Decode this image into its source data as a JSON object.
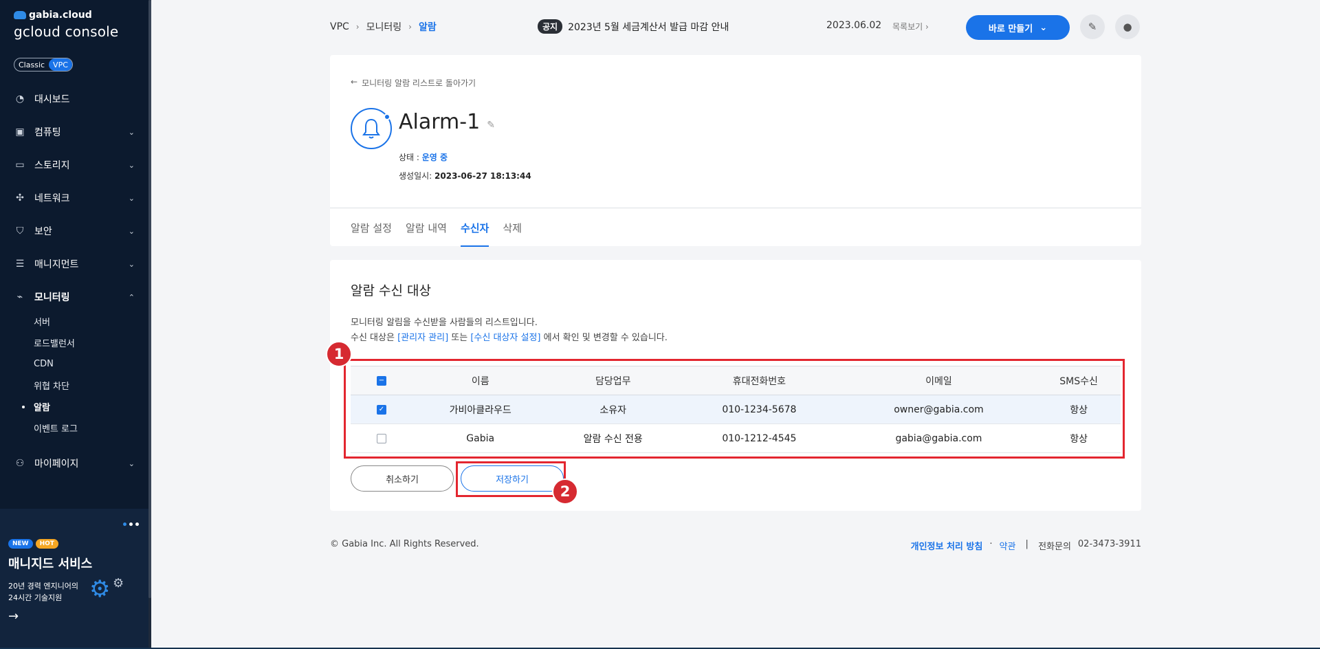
{
  "sidebar": {
    "brand_top": "gabia.cloud",
    "brand_main": "gcloud console",
    "mode_classic": "Classic",
    "mode_vpc": "VPC",
    "items": [
      {
        "label": "대시보드",
        "icon": "gauge-icon"
      },
      {
        "label": "컴퓨팅",
        "icon": "chip-icon"
      },
      {
        "label": "스토리지",
        "icon": "drive-icon"
      },
      {
        "label": "네트워크",
        "icon": "network-icon"
      },
      {
        "label": "보안",
        "icon": "shield-icon"
      },
      {
        "label": "매니지먼트",
        "icon": "server-icon"
      },
      {
        "label": "모니터링",
        "icon": "monitor-icon"
      },
      {
        "label": "마이페이지",
        "icon": "user-icon"
      }
    ],
    "monitoring_sub": [
      "서버",
      "로드밸런서",
      "CDN",
      "위협 차단",
      "알람",
      "이벤트 로그"
    ],
    "promo": {
      "badge_new": "NEW",
      "badge_hot": "HOT",
      "title": "매니지드 서비스",
      "desc_line1": "20년 경력 엔지니어의",
      "desc_line2": "24시간 기술지원"
    }
  },
  "header": {
    "breadcrumb": [
      "VPC",
      "모니터링",
      "알람"
    ],
    "notice_tag": "공지",
    "notice_text": "2023년 5월 세금계산서 발급 마감 안내",
    "notice_date": "2023.06.02",
    "notice_more": "목록보기",
    "make_button": "바로 만들기"
  },
  "alarm": {
    "back_link": "모니터링 알람 리스트로 돌아가기",
    "title": "Alarm-1",
    "status_label": "상태 : ",
    "status_value": "운영 중",
    "created_label": "생성일시: ",
    "created_value": "2023-06-27 18:13:44",
    "tabs": [
      "알람 설정",
      "알람 내역",
      "수신자",
      "삭제"
    ]
  },
  "recipients": {
    "section_title": "알람 수신 대상",
    "desc_line1": "모니터링 알림을 수신받을 사람들의 리스트입니다.",
    "desc_line2_a": "수신 대상은 ",
    "desc_link1": "[관리자 관리]",
    "desc_line2_b": " 또는 ",
    "desc_link2": "[수신 대상자 설정]",
    "desc_line2_c": " 에서 확인 및 변경할 수 있습니다.",
    "columns": [
      "이름",
      "담당업무",
      "휴대전화번호",
      "이메일",
      "SMS수신"
    ],
    "rows": [
      {
        "name": "가비아클라우드",
        "role": "소유자",
        "phone": "010-1234-5678",
        "email": "owner@gabia.com",
        "sms": "항상",
        "checked": true
      },
      {
        "name": "Gabia",
        "role": "알람 수신 전용",
        "phone": "010-1212-4545",
        "email": "gabia@gabia.com",
        "sms": "항상",
        "checked": false
      }
    ],
    "cancel_button": "취소하기",
    "save_button": "저장하기",
    "marker_1": "1",
    "marker_2": "2"
  },
  "footer": {
    "copyright": "© Gabia Inc. All Rights Reserved.",
    "privacy": "개인정보 처리 방침",
    "terms": "약관",
    "phone_label": "전화문의",
    "phone": "02-3473-3911"
  }
}
